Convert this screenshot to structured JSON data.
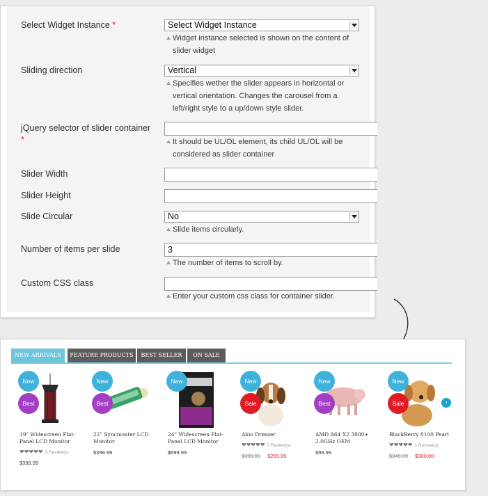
{
  "form": {
    "rows": [
      {
        "label": "Select Widget Instance",
        "required": true,
        "type": "select",
        "value": "Select Widget Instance",
        "note": "Widget instance selected is shown on the content of slider widget"
      },
      {
        "label": "Sliding direction",
        "required": false,
        "type": "select",
        "value": "Vertical",
        "note": "Specifies wether the slider appears in horizontal or vertical orientation. Changes the carousel from a left/right style to a up/down style slider."
      },
      {
        "label": "jQuery selector of slider container",
        "required": true,
        "type": "input",
        "value": "",
        "note": "It should be UL/OL element, its child UL/OL will be considered as slider container"
      },
      {
        "label": "Slider Width",
        "required": false,
        "type": "input",
        "value": "",
        "note": ""
      },
      {
        "label": "Slider Height",
        "required": false,
        "type": "input",
        "value": "",
        "note": ""
      },
      {
        "label": "Slide Circular",
        "required": false,
        "type": "select",
        "value": "No",
        "note": "Slide items circularly."
      },
      {
        "label": "Number of items per slide",
        "required": false,
        "type": "input",
        "value": "3",
        "note": "The number of items to scroll by."
      },
      {
        "label": "Custom CSS class",
        "required": false,
        "type": "input",
        "value": "",
        "note": "Enter your custom css class for container slider."
      }
    ],
    "required_mark": "*"
  },
  "slider": {
    "tabs": [
      "NEW ARRIVALS",
      "FEATURE PRODUCTS",
      "BEST SELLER",
      "ON SALE"
    ],
    "active_tab": 0,
    "products": [
      {
        "name": "19\" Widescreen Flat-Panel LCD Monitor",
        "badges": [
          "New",
          "Best"
        ],
        "rating": 4,
        "reviews": "3 Review(s)",
        "price": "$399.99",
        "old_price": "",
        "thumb": "bird-feeder"
      },
      {
        "name": "22\" Syncmaster LCD Monitor",
        "badges": [
          "New",
          "Best"
        ],
        "rating": 0,
        "reviews": "",
        "price": "$399.99",
        "old_price": "",
        "thumb": "green-toy"
      },
      {
        "name": "24\" Widescreen Flat-Panel LCD Monitor",
        "badges": [
          "New"
        ],
        "rating": 0,
        "reviews": "",
        "price": "$699.99",
        "old_price": "",
        "thumb": "pet-treat-box"
      },
      {
        "name": "Akio Dresser",
        "badges": [
          "New",
          "Sale"
        ],
        "rating": 3,
        "reviews": "3 Review(s)",
        "price": "$259.99",
        "old_price": "$399.99",
        "thumb": "beagle-puppy"
      },
      {
        "name": "AMD A64 X2 3800+ 2.0GHz OEM",
        "badges": [
          "New",
          "Best"
        ],
        "rating": 0,
        "reviews": "",
        "price": "$98.99",
        "old_price": "",
        "thumb": "piglet"
      },
      {
        "name": "BlackBerry 8100 Pearl",
        "badges": [
          "New",
          "Sale"
        ],
        "rating": 4,
        "reviews": "1 Review(s)",
        "price": "$300.00",
        "old_price": "$349.99",
        "thumb": "golden-puppy"
      }
    ],
    "next_icon": "chevron-right-icon",
    "colors": {
      "new_badge": "#3fb2dc",
      "best_badge": "#a23fc4",
      "sale_badge": "#e01b24",
      "active_tab": "#6ec6dc",
      "tab": "#5c5c5c"
    }
  }
}
